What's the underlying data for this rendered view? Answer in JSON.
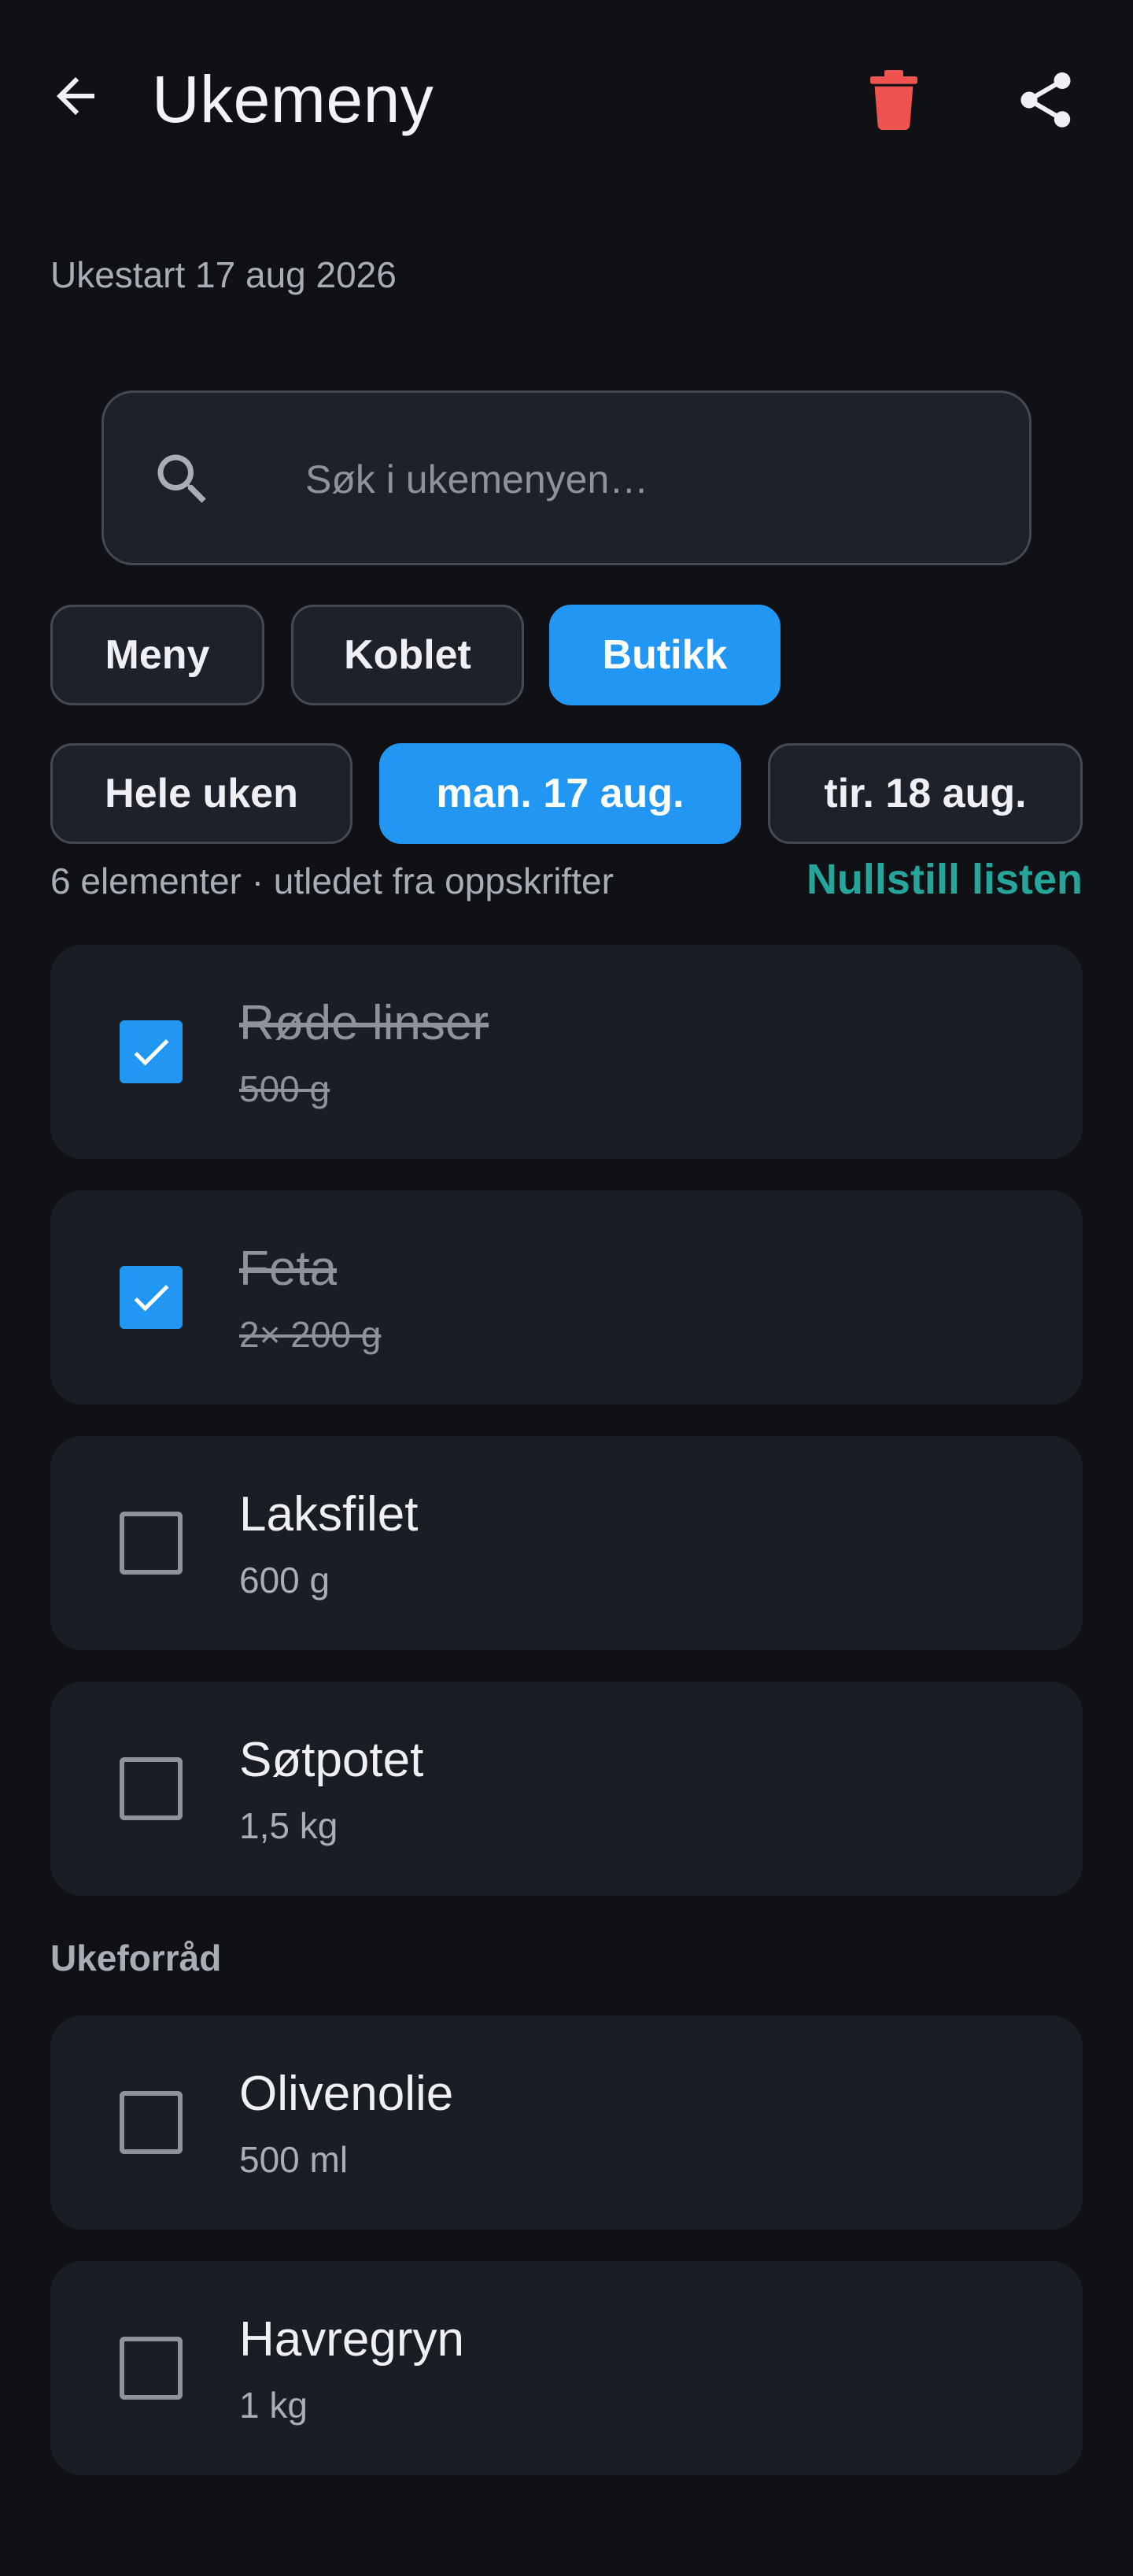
{
  "header": {
    "title": "Ukemeny",
    "back_icon": "arrow-left-icon",
    "delete_icon": "trash-icon",
    "share_icon": "share-icon",
    "delete_color": "#ef5350"
  },
  "week_start": "Ukestart 17 aug 2026",
  "search": {
    "placeholder": "Søk i ukemenyen…",
    "value": ""
  },
  "view_tabs": [
    {
      "label": "Meny",
      "active": false
    },
    {
      "label": "Koblet",
      "active": false
    },
    {
      "label": "Butikk",
      "active": true
    }
  ],
  "day_tabs": [
    {
      "label": "Hele uken",
      "active": false
    },
    {
      "label": "man. 17 aug.",
      "active": true
    },
    {
      "label": "tir. 18 aug.",
      "active": false
    }
  ],
  "list_meta": "6 elementer · utledet fra oppskrifter",
  "reset_label": "Nullstill listen",
  "items": [
    {
      "name": "Røde linser",
      "qty": "500 g",
      "checked": true
    },
    {
      "name": "Feta",
      "qty": "2× 200 g",
      "checked": true
    },
    {
      "name": "Laksfilet",
      "qty": "600 g",
      "checked": false
    },
    {
      "name": "Søtpotet",
      "qty": "1,5 kg",
      "checked": false
    }
  ],
  "pantry_section": {
    "title": "Ukeforråd",
    "items": [
      {
        "name": "Olivenolie",
        "qty": "500 ml",
        "checked": false
      },
      {
        "name": "Havregryn",
        "qty": "1 kg",
        "checked": false
      }
    ]
  },
  "colors": {
    "accent": "#2196f3",
    "link": "#26a69a",
    "background": "#0f1115",
    "card": "#1a1d24"
  }
}
